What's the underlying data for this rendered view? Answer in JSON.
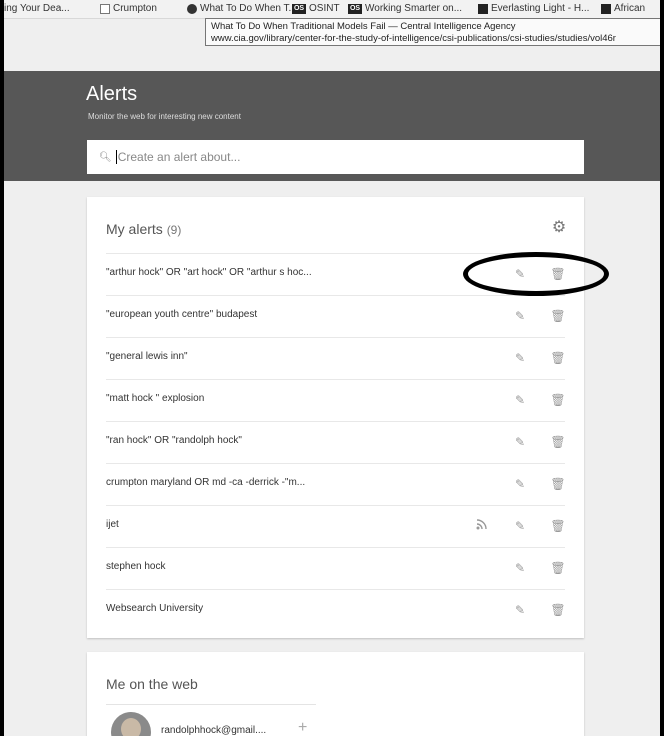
{
  "bookmarks": [
    {
      "label": "ing Your Dea...",
      "icon": "none-icon"
    },
    {
      "label": "Crumpton",
      "icon": "page-icon"
    },
    {
      "label": "What To Do When T...",
      "icon": "cia-seal-icon"
    },
    {
      "label": "OSINT",
      "icon": "os-icon"
    },
    {
      "label": "Working Smarter on...",
      "icon": "os-icon"
    },
    {
      "label": "Everlasting Light - H...",
      "icon": "image-icon"
    },
    {
      "label": "African",
      "icon": "youtube-icon"
    }
  ],
  "tooltip": {
    "title": "What To Do When Traditional Models Fail — Central Intelligence Agency",
    "url": "www.cia.gov/library/center-for-the-study-of-intelligence/csi-publications/csi-studies/studies/vol46r"
  },
  "header": {
    "title": "Alerts",
    "subtitle": "Monitor the web for interesting new content",
    "search_placeholder": "Create an alert about..."
  },
  "alerts": {
    "heading": "My alerts",
    "count": "(9)",
    "items": [
      {
        "label": "\"arthur hock\" OR \"art hock\" OR \"arthur s hoc...",
        "rss": false
      },
      {
        "label": "\"european youth centre\" budapest",
        "rss": false
      },
      {
        "label": "\"general lewis inn\"",
        "rss": false
      },
      {
        "label": "\"matt hock \" explosion",
        "rss": false
      },
      {
        "label": "\"ran hock\" OR \"randolph hock\"",
        "rss": false
      },
      {
        "label": "crumpton maryland OR md -ca -derrick -\"m...",
        "rss": false
      },
      {
        "label": "ijet",
        "rss": true
      },
      {
        "label": "stephen hock",
        "rss": false
      },
      {
        "label": "Websearch University",
        "rss": false
      }
    ]
  },
  "web": {
    "title": "Me on the web",
    "email": "randolphhock@gmail....",
    "add_symbol": "+"
  },
  "colors": {
    "header_bg": "#575757",
    "page_bg": "#efefef",
    "annotation": "#000000"
  }
}
